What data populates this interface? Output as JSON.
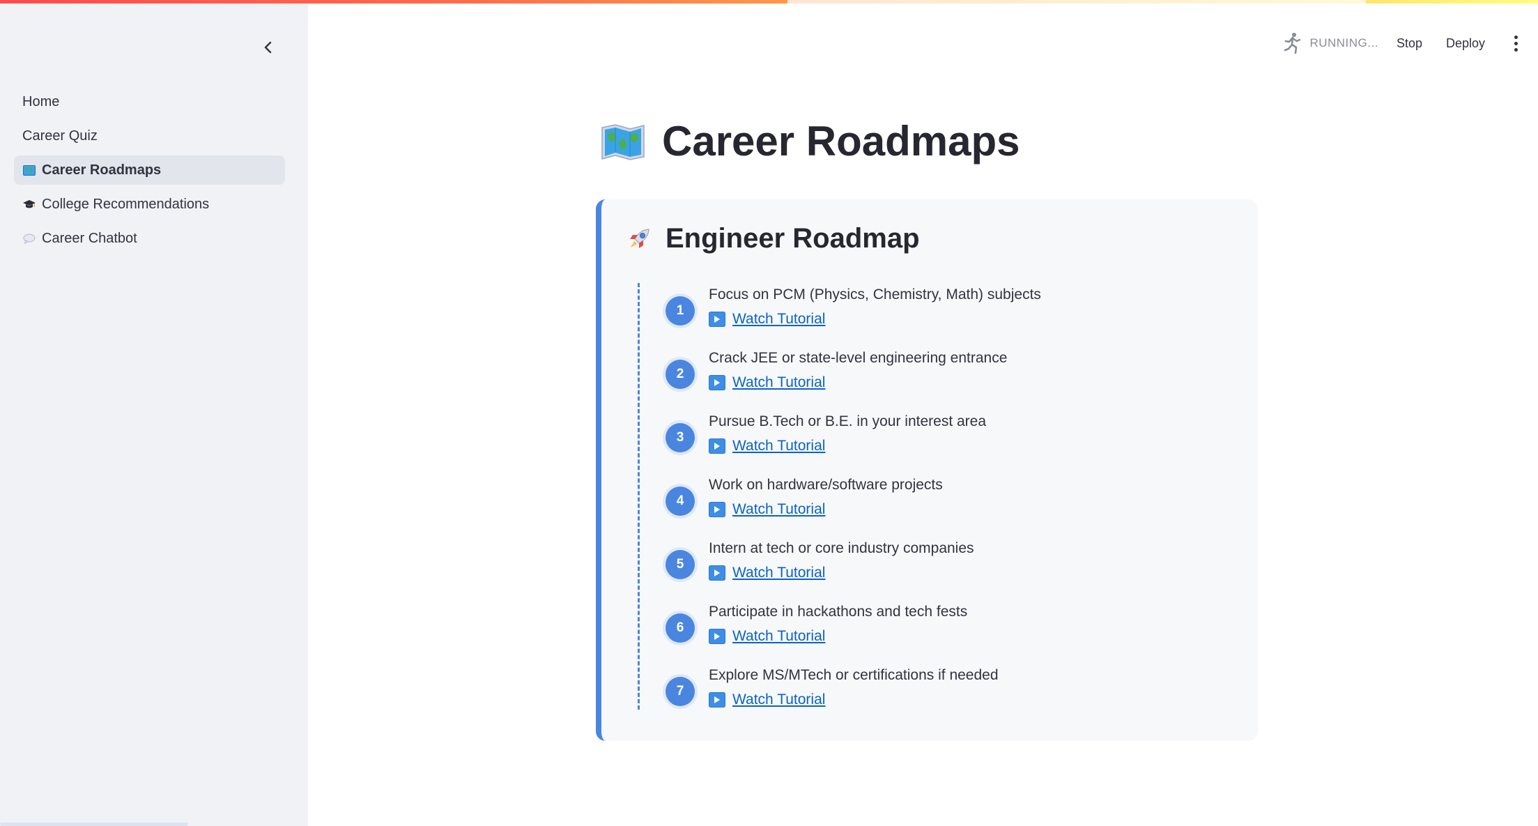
{
  "header": {
    "status": "RUNNING...",
    "stop_label": "Stop",
    "deploy_label": "Deploy"
  },
  "sidebar": {
    "items": [
      {
        "label": "Home",
        "icon": ""
      },
      {
        "label": "Career Quiz",
        "icon": ""
      },
      {
        "label": "Career Roadmaps",
        "icon": "world-map-icon",
        "active": true
      },
      {
        "label": "College Recommendations",
        "icon": "graduation-cap-icon"
      },
      {
        "label": "Career Chatbot",
        "icon": "speech-bubble-icon"
      }
    ]
  },
  "main": {
    "title": "Career Roadmaps",
    "card": {
      "title": "Engineer Roadmap",
      "accent_color": "#4a86e0",
      "steps": [
        {
          "num": "1",
          "text": "Focus on PCM (Physics, Chemistry, Math) subjects",
          "link": "Watch Tutorial"
        },
        {
          "num": "2",
          "text": "Crack JEE or state-level engineering entrance",
          "link": "Watch Tutorial"
        },
        {
          "num": "3",
          "text": "Pursue B.Tech or B.E. in your interest area",
          "link": "Watch Tutorial"
        },
        {
          "num": "4",
          "text": "Work on hardware/software projects",
          "link": "Watch Tutorial"
        },
        {
          "num": "5",
          "text": "Intern at tech or core industry companies",
          "link": "Watch Tutorial"
        },
        {
          "num": "6",
          "text": "Participate in hackathons and tech fests",
          "link": "Watch Tutorial"
        },
        {
          "num": "7",
          "text": "Explore MS/MTech or certifications if needed",
          "link": "Watch Tutorial"
        }
      ]
    }
  }
}
